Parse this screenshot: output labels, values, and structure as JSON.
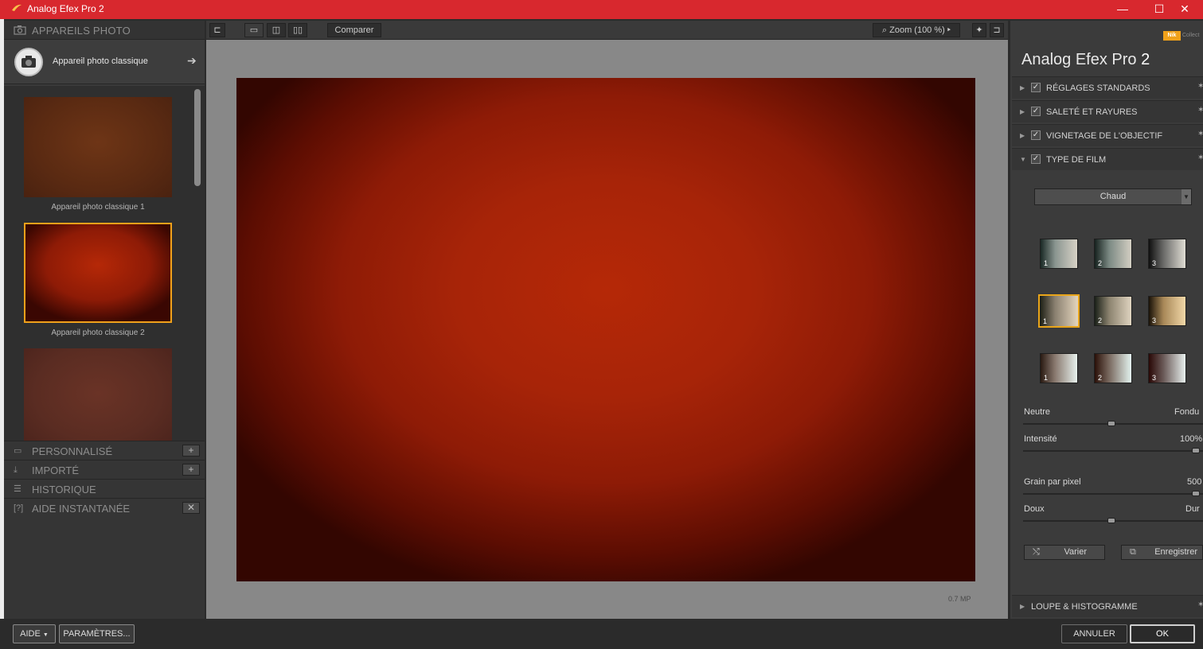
{
  "window": {
    "title": "Analog Efex Pro 2",
    "min": "—",
    "max": "☐",
    "close": "✕"
  },
  "left_panel": {
    "header": "APPAREILS PHOTO",
    "current_camera": "Appareil photo classique",
    "thumbnails": [
      {
        "caption": "Appareil photo classique 1",
        "color": "#6b3418"
      },
      {
        "caption": "Appareil photo classique 2",
        "color": "#a62306"
      },
      {
        "caption": "",
        "color": "#5e2c22"
      }
    ],
    "sections": [
      {
        "label": "PERSONNALISÉ",
        "icon": "preset-icon",
        "btn": "+"
      },
      {
        "label": "IMPORTÉ",
        "icon": "import-icon",
        "btn": "+"
      },
      {
        "label": "HISTORIQUE",
        "icon": "history-icon",
        "btn": ""
      },
      {
        "label": "AIDE INSTANTANÉE",
        "icon": "help-icon",
        "btn": "✕"
      }
    ]
  },
  "toolbar": {
    "compare": "Comparer",
    "zoom": "Zoom (100 %)"
  },
  "canvas": {
    "megapixels": "0.7 MP"
  },
  "right_panel": {
    "brand": "Analog Efex Pro",
    "brand_num": "2",
    "nik_logo": "Nik",
    "nik_sub": "Collect",
    "sections": [
      {
        "label": "RÉGLAGES STANDARDS",
        "checked": true
      },
      {
        "label": "SALETÉ ET RAYURES",
        "checked": true
      },
      {
        "label": "VIGNETAGE DE L'OBJECTIF",
        "checked": true
      },
      {
        "label": "TYPE DE FILM",
        "checked": true
      }
    ],
    "film_dropdown": "Chaud",
    "swatch_labels": [
      "1",
      "2",
      "3",
      "1",
      "2",
      "3",
      "1",
      "2",
      "3"
    ],
    "sliders": [
      {
        "left": "Neutre",
        "right": "Fondu",
        "value": 0.5
      },
      {
        "left": "Intensité",
        "right": "100%",
        "value": 1.0
      },
      {
        "left": "Grain par pixel",
        "right": "500",
        "value": 1.0
      },
      {
        "left": "Doux",
        "right": "Dur",
        "value": 0.5
      }
    ],
    "varier": "Varier",
    "enregistrer": "Enregistrer",
    "loupe": "LOUPE & HISTOGRAMME"
  },
  "bottom": {
    "aide": "AIDE",
    "parametres": "PARAMÈTRES...",
    "annuler": "ANNULER",
    "ok": "OK"
  }
}
